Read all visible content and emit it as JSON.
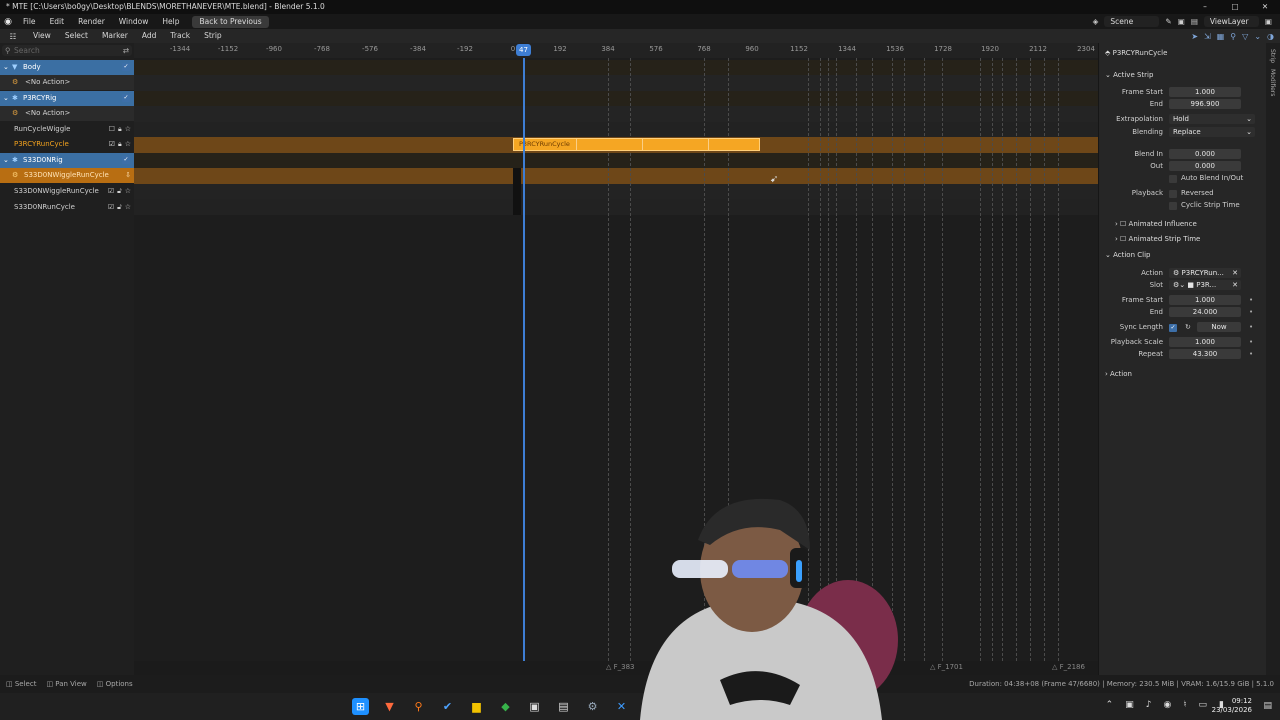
{
  "window": {
    "title": "* MTE [C:\\Users\\bo0gy\\Desktop\\BLENDS\\MORETHANEVER\\MTE.blend] - Blender 5.1.0",
    "controls": [
      "–",
      "□",
      "✕"
    ]
  },
  "menubar": {
    "items": [
      "File",
      "Edit",
      "Render",
      "Window",
      "Help"
    ],
    "back_button": "Back to Previous",
    "scene": "Scene",
    "view_layer": "ViewLayer"
  },
  "editor_header": {
    "items": [
      "View",
      "Select",
      "Marker",
      "Add",
      "Track",
      "Strip"
    ]
  },
  "search": {
    "placeholder": "Search"
  },
  "channels": [
    {
      "kind": "object",
      "label": "Body"
    },
    {
      "kind": "no-action",
      "label": "<No Action>"
    },
    {
      "kind": "object",
      "label": "P3RCYRig"
    },
    {
      "kind": "no-action",
      "label": "<No Action>"
    },
    {
      "kind": "track",
      "label": "RunCycleWiggle"
    },
    {
      "kind": "track-selected",
      "label": "P3RCYRunCycle"
    },
    {
      "kind": "object",
      "label": "S33D0NRig"
    },
    {
      "kind": "action",
      "label": "S33D0NWiggleRunCycle"
    },
    {
      "kind": "track",
      "label": "S33D0NWiggleRunCycle"
    },
    {
      "kind": "track",
      "label": "S33D0NRunCycle"
    }
  ],
  "ruler": {
    "ticks": [
      "-1344",
      "-1152",
      "-960",
      "-768",
      "-576",
      "-384",
      "-192",
      "0",
      "192",
      "384",
      "576",
      "768",
      "960",
      "1152",
      "1344",
      "1536",
      "1728",
      "1920",
      "2112",
      "2304"
    ],
    "current_frame": "47"
  },
  "strip": {
    "label": "P3RCYRunCycle"
  },
  "bottom_markers": [
    "F_383",
    "F_1701",
    "F_2186"
  ],
  "properties": {
    "header": "P3RCYRunCycle",
    "tabs": [
      "Strip",
      "Modifiers"
    ],
    "active_strip": {
      "section": "Active Strip",
      "frame_start_label": "Frame Start",
      "frame_start": "1.000",
      "end_label": "End",
      "end": "996.900",
      "extrapolation_label": "Extrapolation",
      "extrapolation": "Hold",
      "blending_label": "Blending",
      "blending": "Replace",
      "blend_in_label": "Blend In",
      "blend_in": "0.000",
      "out_label": "Out",
      "out": "0.000",
      "auto_blend": "Auto Blend In/Out",
      "playback_label": "Playback",
      "reversed": "Reversed",
      "cyclic": "Cyclic Strip Time",
      "animated_influence": "Animated Influence",
      "animated_strip_time": "Animated Strip Time"
    },
    "action_clip": {
      "section": "Action Clip",
      "action_label": "Action",
      "action": "P3RCYRun...",
      "slot_label": "Slot",
      "slot": "P3R...",
      "frame_start_label": "Frame Start",
      "frame_start": "1.000",
      "end_label": "End",
      "end": "24.000",
      "sync_length_label": "Sync Length",
      "now": "Now",
      "playback_scale_label": "Playback Scale",
      "playback_scale": "1.000",
      "repeat_label": "Repeat",
      "repeat": "43.300"
    },
    "action_section": "Action"
  },
  "statusbar": {
    "left": [
      "Select",
      "Pan View",
      "Options"
    ],
    "right": "Duration: 04:38+08 (Frame 47/6680) | Memory: 230.5 MiB | VRAM: 1.6/15.9 GiB | 5.1.0"
  },
  "taskbar": {
    "time": "09:12",
    "date": "23/03/2026"
  },
  "colors": {
    "accent_blue": "#3e7ed4",
    "strip_orange": "#f5a623",
    "selected_track": "#f2a21e"
  }
}
